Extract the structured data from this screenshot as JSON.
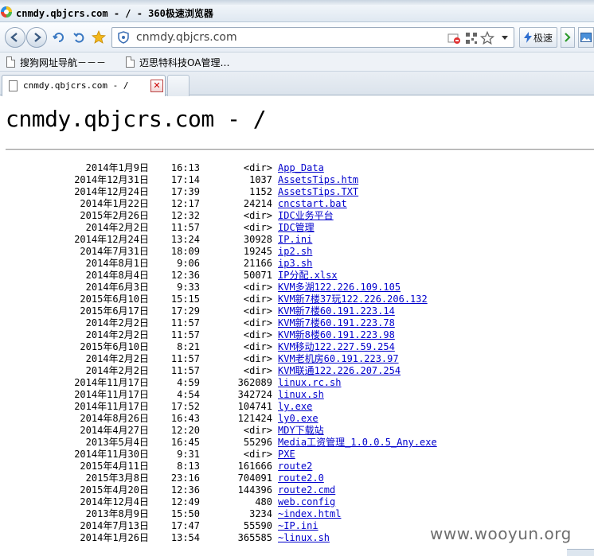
{
  "window": {
    "title": "cnmdy.qbjcrs.com - / - 360极速浏览器"
  },
  "navbar": {
    "address": "cnmdy.qbjcrs.com",
    "speed_label": "极速"
  },
  "bookmarks": [
    {
      "label": "搜狗网址导航－－－"
    },
    {
      "label": "迈思特科技OA管理…"
    }
  ],
  "tabs": [
    {
      "label": "cnmdy.qbjcrs.com - /"
    }
  ],
  "page": {
    "heading": "cnmdy.qbjcrs.com - /",
    "rows": [
      {
        "date": "2014年1月9日",
        "time": "16:13",
        "size": "<dir>",
        "name": "App_Data"
      },
      {
        "date": "2014年12月31日",
        "time": "17:14",
        "size": "1037",
        "name": "AssetsTips.htm"
      },
      {
        "date": "2014年12月24日",
        "time": "17:39",
        "size": "1152",
        "name": "AssetsTips.TXT"
      },
      {
        "date": "2014年1月22日",
        "time": "12:17",
        "size": "24214",
        "name": "cncstart.bat"
      },
      {
        "date": "2015年2月26日",
        "time": "12:32",
        "size": "<dir>",
        "name": "IDC业务平台"
      },
      {
        "date": "2014年2月2日",
        "time": "11:57",
        "size": "<dir>",
        "name": "IDC管理"
      },
      {
        "date": "2014年12月24日",
        "time": "13:24",
        "size": "30928",
        "name": "IP.ini"
      },
      {
        "date": "2014年7月31日",
        "time": "18:09",
        "size": "19245",
        "name": "ip2.sh"
      },
      {
        "date": "2014年8月1日",
        "time": "9:06",
        "size": "21166",
        "name": "ip3.sh"
      },
      {
        "date": "2014年8月4日",
        "time": "12:36",
        "size": "50071",
        "name": "IP分配.xlsx"
      },
      {
        "date": "2014年6月3日",
        "time": "9:33",
        "size": "<dir>",
        "name": "KVM多湖122.226.109.105"
      },
      {
        "date": "2015年6月10日",
        "time": "15:15",
        "size": "<dir>",
        "name": "KVM新7楼37玩122.226.206.132"
      },
      {
        "date": "2015年6月17日",
        "time": "17:29",
        "size": "<dir>",
        "name": "KVM新7楼60.191.223.14"
      },
      {
        "date": "2014年2月2日",
        "time": "11:57",
        "size": "<dir>",
        "name": "KVM新7楼60.191.223.78"
      },
      {
        "date": "2014年2月2日",
        "time": "11:57",
        "size": "<dir>",
        "name": "KVM新8楼60.191.223.98"
      },
      {
        "date": "2015年6月10日",
        "time": "8:21",
        "size": "<dir>",
        "name": "KVM移动122.227.59.254"
      },
      {
        "date": "2014年2月2日",
        "time": "11:57",
        "size": "<dir>",
        "name": "KVM老机房60.191.223.97"
      },
      {
        "date": "2014年2月2日",
        "time": "11:57",
        "size": "<dir>",
        "name": "KVM联通122.226.207.254"
      },
      {
        "date": "2014年11月17日",
        "time": "4:59",
        "size": "362089",
        "name": "linux.rc.sh"
      },
      {
        "date": "2014年11月17日",
        "time": "4:54",
        "size": "342724",
        "name": "linux.sh"
      },
      {
        "date": "2014年11月17日",
        "time": "17:52",
        "size": "104741",
        "name": "ly.exe"
      },
      {
        "date": "2014年8月26日",
        "time": "16:43",
        "size": "121424",
        "name": "ly0.exe"
      },
      {
        "date": "2014年4月27日",
        "time": "12:20",
        "size": "<dir>",
        "name": "MDY下载站"
      },
      {
        "date": "2013年5月4日",
        "time": "16:45",
        "size": "55296",
        "name": "Media工资管理_1.0.0.5_Any.exe"
      },
      {
        "date": "2014年11月30日",
        "time": "9:31",
        "size": "<dir>",
        "name": "PXE"
      },
      {
        "date": "2015年4月11日",
        "time": "8:13",
        "size": "161666",
        "name": "route2"
      },
      {
        "date": "2015年3月8日",
        "time": "23:16",
        "size": "704091",
        "name": "route2.0"
      },
      {
        "date": "2015年4月20日",
        "time": "12:36",
        "size": "144396",
        "name": "route2.cmd"
      },
      {
        "date": "2014年12月4日",
        "time": "12:49",
        "size": "480",
        "name": "web.config"
      },
      {
        "date": "2013年8月9日",
        "time": "15:50",
        "size": "3234",
        "name": "~index.html"
      },
      {
        "date": "2014年7月13日",
        "time": "17:47",
        "size": "55590",
        "name": "~IP.ini"
      },
      {
        "date": "2014年1月26日",
        "time": "13:54",
        "size": "365585",
        "name": "~linux.sh"
      }
    ]
  },
  "watermark": "www.wooyun.org",
  "colors": {
    "link": "#0000cc",
    "chrome_blue": "#dfe8f1",
    "close_red": "#cc0000"
  }
}
